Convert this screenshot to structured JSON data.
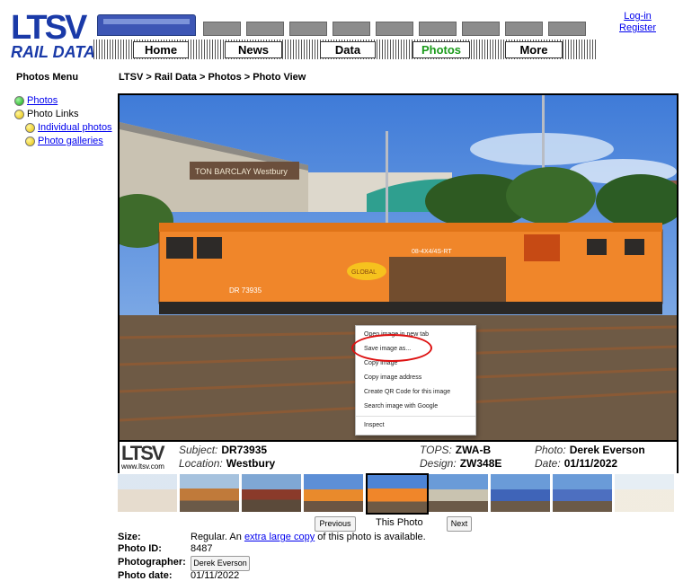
{
  "header": {
    "logo_text": "LTSV",
    "logo_subtitle": "RAIL DATA",
    "nav": [
      "Home",
      "News",
      "Data",
      "Photos",
      "More"
    ],
    "active_nav": "Photos",
    "login": "Log-in",
    "register": "Register"
  },
  "sidebar": {
    "title": "Photos Menu",
    "items": [
      {
        "label": "Photos",
        "link": true,
        "dot": "green"
      },
      {
        "label": "Photo Links",
        "link": false,
        "dot": "yellow"
      },
      {
        "label": "Individual photos",
        "link": true,
        "dot": "yellow"
      },
      {
        "label": "Photo galleries",
        "link": true,
        "dot": "yellow"
      }
    ]
  },
  "breadcrumb": "LTSV > Rail Data > Photos > Photo View",
  "photo": {
    "building_sign": "TON BARCLAY  Westbury",
    "loco_number": "DR 73935",
    "side_text": "08-4X4/4S-RT",
    "brand": "GLOBAL"
  },
  "caption": {
    "site": "www.ltsv.com",
    "subject_label": "Subject:",
    "subject": "DR73935",
    "location_label": "Location:",
    "location": "Westbury",
    "tops_label": "TOPS:",
    "tops": "ZWA-B",
    "design_label": "Design:",
    "design": "ZW348E",
    "photo_label": "Photo:",
    "photographer": "Derek Everson",
    "date_label": "Date:",
    "date": "01/11/2022"
  },
  "context_menu": {
    "items": [
      "Open image in new tab",
      "Save image as...",
      "Copy image",
      "Copy image address",
      "Create QR Code for this image",
      "Search image with Google",
      "Inspect"
    ]
  },
  "pager": {
    "previous": "Previous",
    "this_photo": "This Photo",
    "next": "Next"
  },
  "details": {
    "size_label": "Size:",
    "size_prefix": "Regular. An",
    "size_link": "extra large copy",
    "size_suffix": "of this photo is available.",
    "id_label": "Photo ID:",
    "id": "8487",
    "photographer_label": "Photographer:",
    "photographer": "Derek Everson",
    "date_label": "Photo date:",
    "date": "01/11/2022"
  },
  "colors": {
    "brand_blue": "#1a3aa8",
    "active_nav": "#1a9a1a",
    "machine_orange": "#f0862a",
    "highlight_ring": "#dd1111"
  }
}
